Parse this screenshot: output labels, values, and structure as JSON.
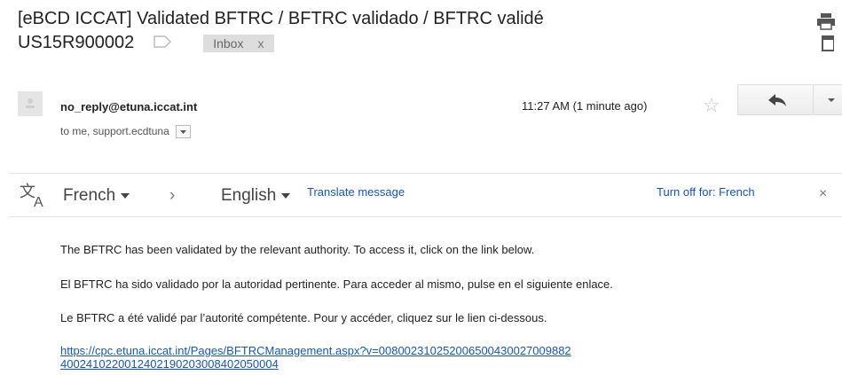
{
  "subject": {
    "line1": "[eBCD ICCAT] Validated BFTRC / BFTRC validado / BFTRC validé",
    "line2": "US15R900002",
    "label_chip": "Inbox",
    "label_chip_close": "x"
  },
  "header": {
    "sender": "no_reply@etuna.iccat.int",
    "recipients": "to me, support.ecdtuna",
    "time": "11:27 AM (1 minute ago)"
  },
  "translate_bar": {
    "from_lang": "French",
    "arrow": "›",
    "to_lang": "English",
    "translate_link": "Translate message",
    "turn_off": "Turn off for: French",
    "close": "×"
  },
  "body": {
    "line_en": "The BFTRC has been validated by the relevant authority. To access it, click on the link below.",
    "line_es": "El BFTRC ha sido validado por la autoridad pertinente. Para acceder al mismo, pulse en el siguiente enlace.",
    "line_fr": "Le BFTRC a été validé par l’autorité compétente. Pour y accéder, cliquez sur le lien ci-dessous.",
    "link_line1": "https://cpc.etuna.iccat.int/Pages/BFTRCManagement.aspx?v=008002310252006500430027009882",
    "link_line2": "4002410220012402190203008402050004"
  },
  "colors": {
    "link": "#1155cc",
    "chip_bg": "#dddddd"
  }
}
